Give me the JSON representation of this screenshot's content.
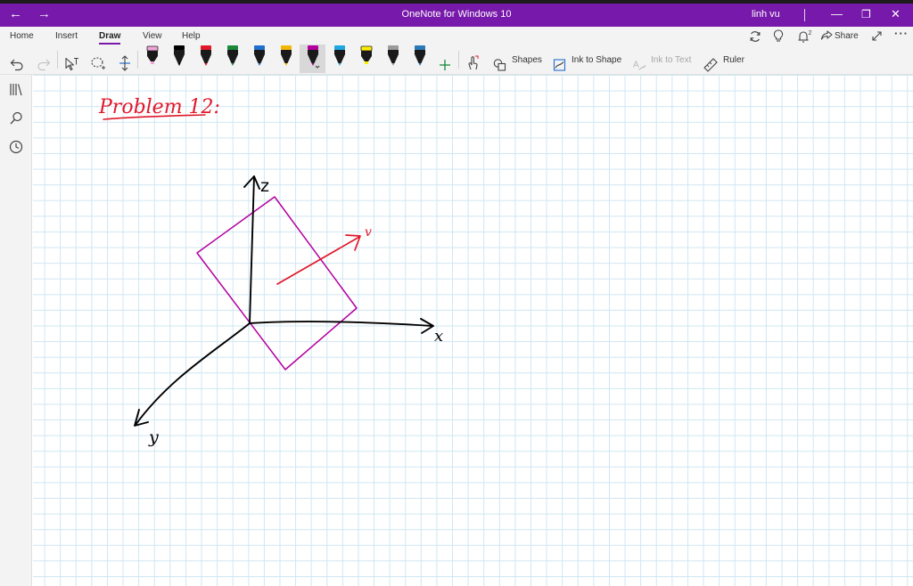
{
  "window": {
    "title": "OneNote for Windows 10",
    "user": "linh vu",
    "back_icon": "arrow-left-icon",
    "forward_icon": "arrow-right-icon",
    "minimize_glyph": "—",
    "restore_glyph": "❐",
    "close_glyph": "✕"
  },
  "ribbon": {
    "tabs": [
      {
        "label": "Home"
      },
      {
        "label": "Insert"
      },
      {
        "label": "Draw",
        "active": true
      },
      {
        "label": "View"
      },
      {
        "label": "Help"
      }
    ],
    "share_label": "Share",
    "notification_count": "2",
    "tools": {
      "shapes": "Shapes",
      "ink_to_shape": "Ink to Shape",
      "ink_to_text": "Ink to Text",
      "ruler": "Ruler"
    },
    "pens": [
      {
        "type": "highlighter",
        "color": "#f0a6d8"
      },
      {
        "type": "pen",
        "color": "#000000"
      },
      {
        "type": "pen",
        "color": "#e0182a"
      },
      {
        "type": "pen",
        "color": "#1a8a3a"
      },
      {
        "type": "pen",
        "color": "#1f6fd0"
      },
      {
        "type": "pen",
        "color": "#f2b705"
      },
      {
        "type": "pen",
        "color": "#b4009e",
        "selected": true
      },
      {
        "type": "pen",
        "color": "#1ea7e1"
      },
      {
        "type": "highlighter",
        "color": "#ffee00"
      },
      {
        "type": "pen",
        "color": "#9a9a9a"
      },
      {
        "type": "pen",
        "color": "#2a7ab8"
      }
    ]
  },
  "colors": {
    "accent": "#7719aa",
    "grid_line": "#cfe6f3",
    "ink_red": "#e0182a",
    "ink_magenta": "#b4009e",
    "ink_black": "#000000"
  },
  "canvas": {
    "heading": "Problem 12:",
    "axis_labels": {
      "z": "z",
      "x": "x",
      "y": "y",
      "vector": "v"
    }
  }
}
